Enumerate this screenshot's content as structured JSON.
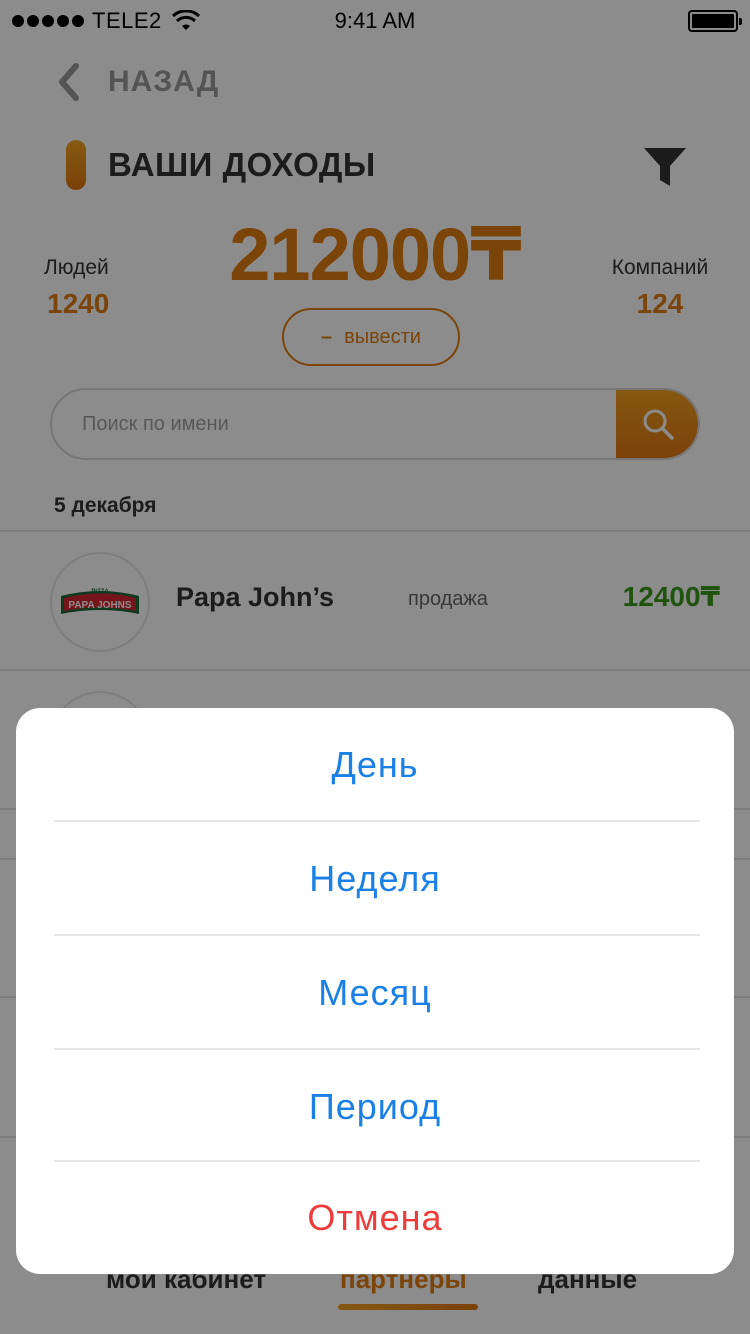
{
  "status_bar": {
    "carrier": "TELE2",
    "time": "9:41 AM",
    "icons": [
      "signal-icon",
      "wifi-icon",
      "battery-icon"
    ]
  },
  "nav": {
    "back_label": "НАЗАД"
  },
  "header": {
    "title": "ВАШИ ДОХОДЫ",
    "filter_icon": "filter-icon"
  },
  "summary": {
    "people_label": "Людей",
    "people_value": "1240",
    "total_amount": "212000₸",
    "companies_label": "Компаний",
    "companies_value": "124",
    "withdraw_dash": "–",
    "withdraw_label": "вывести"
  },
  "search": {
    "placeholder": "Поиск по имени",
    "value": "",
    "button_icon": "search-icon"
  },
  "list": {
    "date_header": "5 декабря",
    "items": [
      {
        "logo": "PAPA JOHNS",
        "logo_top": "PIZZA",
        "name": "Papa John’s",
        "type": "продажа",
        "amount": "12400₸"
      }
    ]
  },
  "tab_bar": {
    "tabs": [
      {
        "label": "мой кабинет",
        "active": false
      },
      {
        "label": "партнеры",
        "active": true
      },
      {
        "label": "данные",
        "active": false
      }
    ]
  },
  "action_sheet": {
    "options": [
      "День",
      "Неделя",
      "Месяц",
      "Период"
    ],
    "cancel_label": "Отмена"
  },
  "colors": {
    "accent": "#e07c10",
    "amount_positive": "#3a9a1a",
    "sheet_option": "#1a80e6",
    "sheet_cancel": "#ee3b3b"
  }
}
